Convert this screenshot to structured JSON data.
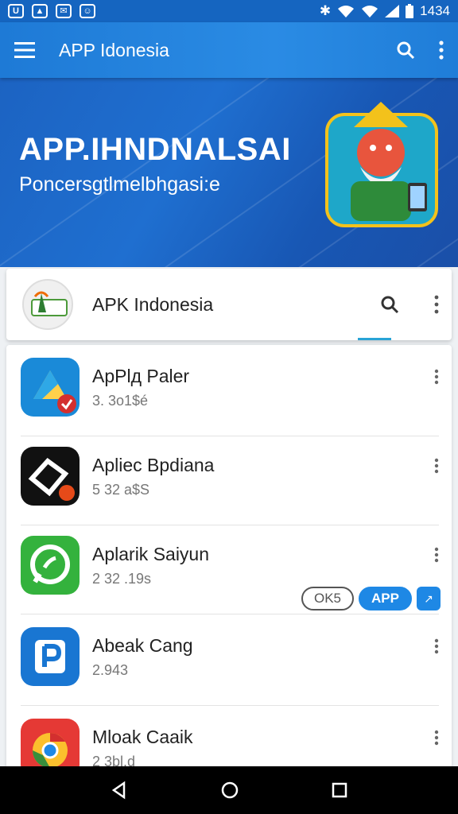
{
  "status_bar": {
    "left_icons": [
      "notification-icon",
      "gallery-icon",
      "message-icon",
      "chat-icon"
    ],
    "time": "1434"
  },
  "app_bar": {
    "title": "APP Idonesia"
  },
  "banner": {
    "headline": "APP.IHNDNALSAI",
    "subtitle": "Poncersgtlmelbhgasi:e"
  },
  "search_card": {
    "app_name": "APK Indonesia"
  },
  "apps": [
    {
      "name": "ApPlд Paler",
      "meta": "3. 3o1$é",
      "icon": "drive-icon"
    },
    {
      "name": "Apliec Bpdiana",
      "meta": "5 32 a$S",
      "icon": "diamond-icon"
    },
    {
      "name": "Aplarik Saiyun",
      "meta": "2 32 .19s",
      "icon": "phone-chat-icon"
    },
    {
      "name": "Abeak Cang",
      "meta": "2.943",
      "icon": "p-icon"
    },
    {
      "name": "Mloak Caaik",
      "meta": "2 3bl.d",
      "icon": "chrome-icon"
    }
  ],
  "chips": {
    "outline": "OK5",
    "app": "APP",
    "square": "↗"
  },
  "colors": {
    "accent": "#1e88e5",
    "app_bar": "#2a8be4",
    "banner": "#1c63c2"
  }
}
